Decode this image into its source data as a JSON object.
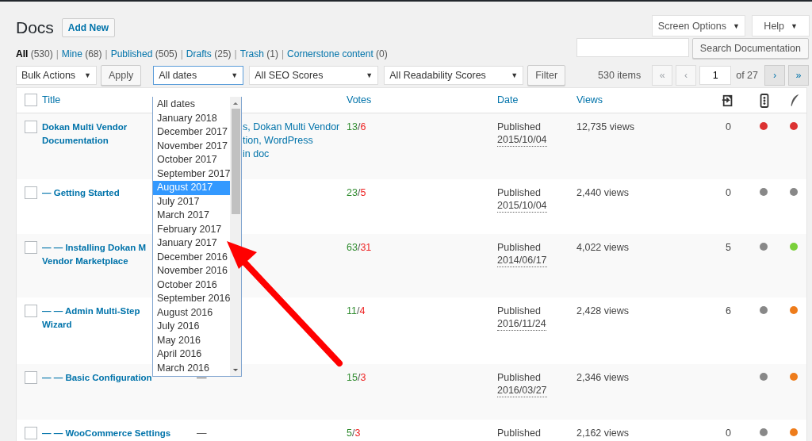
{
  "top_tabs": [
    {
      "label": "Screen Options",
      "caret": "▼"
    },
    {
      "label": "Help",
      "caret": "▼"
    }
  ],
  "page_title": "Docs",
  "add_new": "Add New",
  "search": {
    "button": "Search Documentation"
  },
  "status_filters": [
    {
      "label": "All",
      "count": "(530)",
      "selected": true
    },
    {
      "label": "Mine",
      "count": "(68)",
      "selected": false
    },
    {
      "label": "Published",
      "count": "(505)",
      "selected": false
    },
    {
      "label": "Drafts",
      "count": "(25)",
      "selected": false
    },
    {
      "label": "Trash",
      "count": "(1)",
      "selected": false
    },
    {
      "label": "Cornerstone content",
      "count": "(0)",
      "selected": false
    }
  ],
  "separator": "|",
  "bulk_actions": {
    "value": "Bulk Actions",
    "caret": "▼",
    "apply": "Apply"
  },
  "filters": [
    {
      "kind": "date",
      "value": "All dates",
      "caret": "▼",
      "open": true
    },
    {
      "kind": "seo",
      "value": "All SEO Scores",
      "caret": "▼",
      "open": false
    },
    {
      "kind": "readability",
      "value": "All Readability Scores",
      "caret": "▼",
      "open": false
    }
  ],
  "filter_button": "Filter",
  "date_options": [
    {
      "label": "All dates",
      "selected": false
    },
    {
      "label": "January 2018",
      "selected": false
    },
    {
      "label": "December 2017",
      "selected": false
    },
    {
      "label": "November 2017",
      "selected": false
    },
    {
      "label": "October 2017",
      "selected": false
    },
    {
      "label": "September 2017",
      "selected": false
    },
    {
      "label": "August 2017",
      "selected": true
    },
    {
      "label": "July 2017",
      "selected": false
    },
    {
      "label": "March 2017",
      "selected": false
    },
    {
      "label": "February 2017",
      "selected": false
    },
    {
      "label": "January 2017",
      "selected": false
    },
    {
      "label": "December 2016",
      "selected": false
    },
    {
      "label": "November 2016",
      "selected": false
    },
    {
      "label": "October 2016",
      "selected": false
    },
    {
      "label": "September 2016",
      "selected": false
    },
    {
      "label": "August 2016",
      "selected": false
    },
    {
      "label": "July 2016",
      "selected": false
    },
    {
      "label": "May 2016",
      "selected": false
    },
    {
      "label": "April 2016",
      "selected": false
    },
    {
      "label": "March 2016",
      "selected": false
    }
  ],
  "pagination": {
    "items": "530 items",
    "first": "«",
    "prev": "‹",
    "page": "1",
    "of": "of 27",
    "next": "›",
    "last": "»",
    "first_disabled": true,
    "last_disabled": false
  },
  "table": {
    "header_checked": false,
    "columns": [
      {
        "kind": "title",
        "label": "Title"
      },
      {
        "kind": "categories"
      },
      {
        "kind": "votes",
        "label": "Votes"
      },
      {
        "kind": "date",
        "label": "Date"
      },
      {
        "kind": "views",
        "label": "Views"
      },
      {
        "kind": "links"
      },
      {
        "kind": "seo"
      },
      {
        "kind": "readability"
      }
    ],
    "rows": [
      {
        "checked": false,
        "title": [
          "Dokan Multi Vendor",
          "Documentation"
        ],
        "categories": [
          "s, Dokan Multi Vendor",
          "tion, WordPress",
          "in doc"
        ],
        "votes": {
          "up": "13",
          "slash": "/",
          "down": "6"
        },
        "status": "Published",
        "date": "2015/10/04",
        "views": "12,735 views",
        "links": "0",
        "seo": {
          "color": "#dc3232"
        },
        "readability": {
          "color": "#dc3232"
        }
      },
      {
        "checked": false,
        "title": [
          "— Getting Started"
        ],
        "votes": {
          "up": "23",
          "slash": "/",
          "down": "5"
        },
        "status": "Published",
        "date": "2015/10/04",
        "views": "2,440 views",
        "links": "0",
        "seo": {
          "color": "#888888"
        },
        "readability": {
          "color": "#888888"
        }
      },
      {
        "checked": false,
        "title": [
          "— — Installing Dokan M",
          "Vendor Marketplace"
        ],
        "votes": {
          "up": "63",
          "slash": "/",
          "down": "31"
        },
        "status": "Published",
        "date": "2014/06/17",
        "views": "4,022 views",
        "links": "5",
        "seo": {
          "color": "#888888"
        },
        "readability": {
          "color": "#7ad03a"
        }
      },
      {
        "checked": false,
        "title": [
          "— — Admin Multi-Step",
          "Wizard"
        ],
        "votes": {
          "up": "11",
          "slash": "/",
          "down": "4"
        },
        "status": "Published",
        "date": "2016/11/24",
        "views": "2,428 views",
        "links": "6",
        "seo": {
          "color": "#888888"
        },
        "readability": {
          "color": "#ee7c1b"
        }
      },
      {
        "checked": false,
        "title": [
          "— — Basic Configuration"
        ],
        "categories": [
          "—"
        ],
        "votes": {
          "up": "15",
          "slash": "/",
          "down": "3"
        },
        "status": "Published",
        "date": "2016/03/27",
        "views": "2,346 views",
        "seo": {
          "color": "#888888"
        },
        "readability": {
          "color": "#ee7c1b"
        }
      },
      {
        "checked": false,
        "title": [
          "— — WooCommerce Settings"
        ],
        "categories": [
          "—"
        ],
        "votes": {
          "up": "5",
          "slash": "/",
          "down": "3"
        },
        "status": "Published",
        "views": "2,162 views",
        "links": "0",
        "seo": {
          "color": "#888888"
        },
        "readability": {
          "color": "#ee7c1b"
        }
      }
    ]
  }
}
